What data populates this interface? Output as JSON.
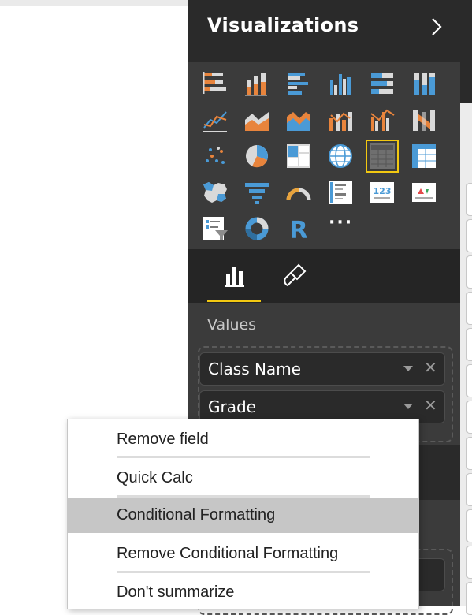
{
  "visualizations_pane": {
    "title": "Visualizations",
    "expand_icon": "chevron-right-icon",
    "icons": [
      "stacked-bar-chart-icon",
      "stacked-column-chart-icon",
      "clustered-bar-chart-icon",
      "clustered-column-chart-icon",
      "100-stacked-bar-chart-icon",
      "100-stacked-column-chart-icon",
      "line-chart-icon",
      "area-chart-icon",
      "stacked-area-chart-icon",
      "line-and-stacked-column-chart-icon",
      "line-and-clustered-column-chart-icon",
      "ribbon-chart-icon",
      "scatter-chart-icon",
      "pie-chart-icon",
      "treemap-icon",
      "map-icon",
      "table-icon",
      "matrix-icon",
      "filled-map-icon",
      "funnel-icon",
      "gauge-icon",
      "multi-row-card-icon",
      "card-icon",
      "kpi-icon",
      "slicer-icon",
      "donut-chart-icon",
      "r-script-visual-icon"
    ],
    "selected_icon": "table-icon",
    "more_label": "···",
    "tabs": [
      {
        "name": "fields-tab",
        "icon": "fields-icon",
        "active": true
      },
      {
        "name": "format-tab",
        "icon": "paint-roller-icon",
        "active": false
      }
    ],
    "values_label": "Values",
    "fields": [
      {
        "name": "Class Name"
      },
      {
        "name": "Grade"
      }
    ]
  },
  "context_menu": {
    "items": [
      {
        "label": "Remove field",
        "highlighted": false
      },
      {
        "label": "Quick Calc",
        "highlighted": false
      },
      {
        "label": "Conditional Formatting",
        "highlighted": true
      },
      {
        "label": "Remove Conditional Formatting",
        "highlighted": false
      },
      {
        "label": "Don't summarize",
        "highlighted": false
      }
    ]
  },
  "colors": {
    "pane_dark": "#2f2f2f",
    "accent_yellow": "#f2c811",
    "icon_orange": "#e8843c",
    "icon_blue": "#4a9ad6"
  }
}
